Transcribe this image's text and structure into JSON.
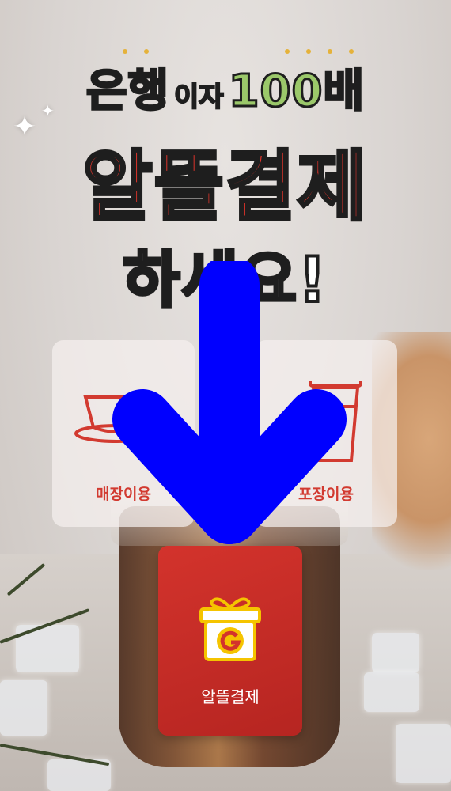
{
  "headline": {
    "line1_left": "은행",
    "line1_mid": "이자",
    "line1_right": "100배",
    "line2": "알뜰결제",
    "line3": "하세요!"
  },
  "options": [
    {
      "label": "매장이용",
      "icon": "coffee-cup-icon"
    },
    {
      "label": "포장이용",
      "icon": "takeout-cup-icon"
    }
  ],
  "payment": {
    "label": "알뜰결제",
    "icon": "gift-box-g-icon",
    "accent": "#c92d26"
  },
  "overlay": {
    "icon": "down-arrow-icon",
    "color": "#0000ff"
  },
  "colors": {
    "green": "#9bc86a",
    "red": "#e0342b",
    "card_red": "#d23a30"
  }
}
